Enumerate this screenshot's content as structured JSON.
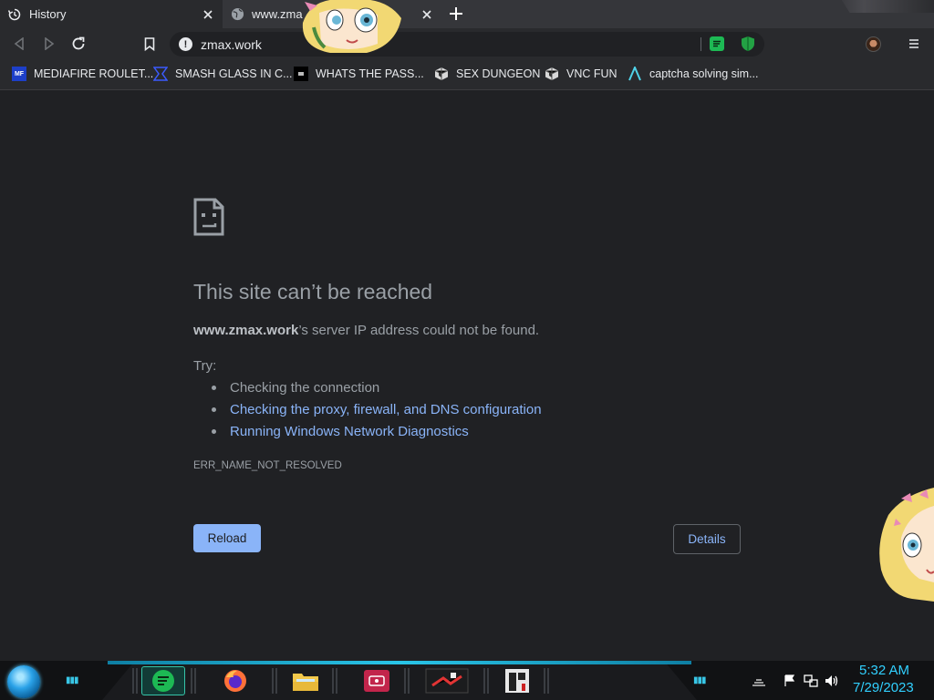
{
  "browser": {
    "tabs": [
      {
        "title": "History",
        "icon": "history-icon",
        "active": true
      },
      {
        "title": "www.zma",
        "icon": "globe-icon",
        "active": false
      }
    ],
    "address_bar": {
      "url": "zmax.work",
      "security_icon": "info-icon"
    },
    "toolbar_icons": [
      "back-arrow-icon",
      "forward-arrow-icon",
      "reload-icon",
      "bookmark-icon",
      "spotify-extension-icon",
      "shield-extension-icon",
      "profile-avatar-icon",
      "menu-icon"
    ],
    "bookmarks": [
      {
        "label": "MEDIAFIRE ROULET...",
        "icon": "mediafire-icon",
        "icon_text": "MF"
      },
      {
        "label": "SMASH GLASS IN C...",
        "icon": "chevron-bookmark-icon"
      },
      {
        "label": "WHATS THE PASS...",
        "icon": "dark-square-icon"
      },
      {
        "label": "SEX DUNGEON",
        "icon": "cube-icon"
      },
      {
        "label": "VNC FUN",
        "icon": "cube-icon"
      },
      {
        "label": "captcha solving sim...",
        "icon": "lambda-icon"
      }
    ]
  },
  "error_page": {
    "title": "This site can’t be reached",
    "host": "www.zmax.work",
    "summary_rest": "’s server IP address could not be found.",
    "try_label": "Try:",
    "suggestions": [
      {
        "text": "Checking the connection",
        "link": false
      },
      {
        "text": "Checking the proxy, firewall, and DNS configuration",
        "link": true
      },
      {
        "text": "Running Windows Network Diagnostics",
        "link": true
      }
    ],
    "error_code": "ERR_NAME_NOT_RESOLVED",
    "reload_label": "Reload",
    "details_label": "Details"
  },
  "taskbar": {
    "apps": [
      "spotify-app",
      "firefox-app",
      "file-explorer-app",
      "screen-capture-app",
      "game-window-app",
      "terminal-window-app"
    ],
    "tray_icons": [
      "show-hidden-icon",
      "action-center-flag-icon",
      "network-icon",
      "volume-icon"
    ],
    "time": "5:32 AM",
    "date": "7/29/2023"
  },
  "colors": {
    "accent_link": "#8ab4f8",
    "page_bg": "#202124",
    "clock": "#31d0ff",
    "taskbar_glow": "#29c5e8"
  }
}
